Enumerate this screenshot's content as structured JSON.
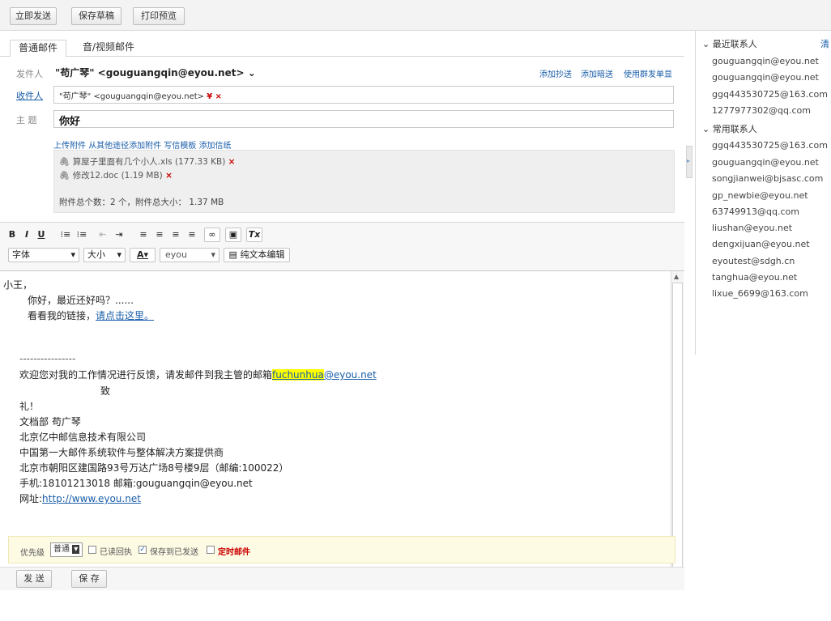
{
  "toolbar": {
    "send": "立即发送",
    "draft": "保存草稿",
    "print": "打印预览"
  },
  "tabs": [
    "普通邮件",
    "音/视频邮件"
  ],
  "sender": {
    "label": "发件人",
    "value": "\"苟广琴\" <gouguangqin@eyou.net>",
    "chevron": "⌄"
  },
  "options": {
    "cc": "添加抄送",
    "bcc": "添加暗送",
    "group": "使用群发单显"
  },
  "recipients": {
    "label": "收件人",
    "chip": "\"苟广琴\" <gouguangqin@eyou.net>",
    "chip_icons": "¥ ×"
  },
  "subject": {
    "label": "主 题",
    "value": "你好"
  },
  "attach_links": {
    "upload": "上传附件",
    "other": "从其他途径添加附件",
    "template": "写信模板",
    "stationery": "添加信纸"
  },
  "attachments": [
    {
      "name": "算屋子里面有几个小人.xls (177.33 KB)"
    },
    {
      "name": "修改12.doc (1.19 MB)"
    }
  ],
  "attach_summary": "附件总个数：2 个，附件总大小： 1.37 MB",
  "editor_toolbar": {
    "font": "字体",
    "size": "大小",
    "font_name": "eyou",
    "plain": "纯文本编辑",
    "buttons": [
      "B",
      "I",
      "U",
      "⁝≡",
      "⁝≡",
      "⇤",
      "⇥",
      "≡",
      "≡",
      "≡",
      "≡",
      "∞",
      "▣",
      "Tx"
    ]
  },
  "body": {
    "greeting": "小王，",
    "line1": "你好，最近还好吗？......",
    "line2_text": "看看我的链接，",
    "line2_link": "请点击这里。",
    "divider": "----------------",
    "feedback_text": "欢迎您对我的工作情况进行反馈，请发邮件到我主管的邮箱",
    "feedback_hl": "fuchunhua",
    "feedback_domain": "@eyou.net",
    "zhi": "致",
    "li": "礼！",
    "sig1": "文档部 苟广琴",
    "sig2": "北京亿中邮信息技术有限公司",
    "sig3": "中国第一大邮件系统软件与整体解决方案提供商",
    "sig4": "北京市朝阳区建国路93号万达广场8号楼9层（邮编:100022）",
    "sig5": "手机:18101213018  邮箱:gouguangqin@eyou.net",
    "sig6_label": "网址:",
    "sig6_link": "http://www.eyou.net"
  },
  "bottom_options": {
    "priority_label": "优先级",
    "priority_value": "普通",
    "read_receipt": "已读回执",
    "save_sent": "保存到已发送",
    "scheduled": "定时邮件"
  },
  "send_buttons": {
    "send": "发 送",
    "save": "保 存"
  },
  "contacts": {
    "recent_label": "最近联系人",
    "clear_label": "清",
    "recent": [
      "gouguangqin@eyou.net",
      "gouguangqin@eyou.net",
      "ggq443530725@163.com",
      "1277977302@qq.com"
    ],
    "frequent_label": "常用联系人",
    "frequent": [
      "ggq443530725@163.com",
      "gouguangqin@eyou.net",
      "songjianwei@bjsasc.com",
      "gp_newbie@eyou.net",
      "63749913@qq.com",
      "liushan@eyou.net",
      "dengxijuan@eyou.net",
      "eyoutest@sdgh.cn",
      "tanghua@eyou.net",
      "lixue_6699@163.com"
    ]
  },
  "colors": {
    "link": "#1a5ea9",
    "highlight": "#ffff00",
    "accent_red": "#cc0000"
  }
}
